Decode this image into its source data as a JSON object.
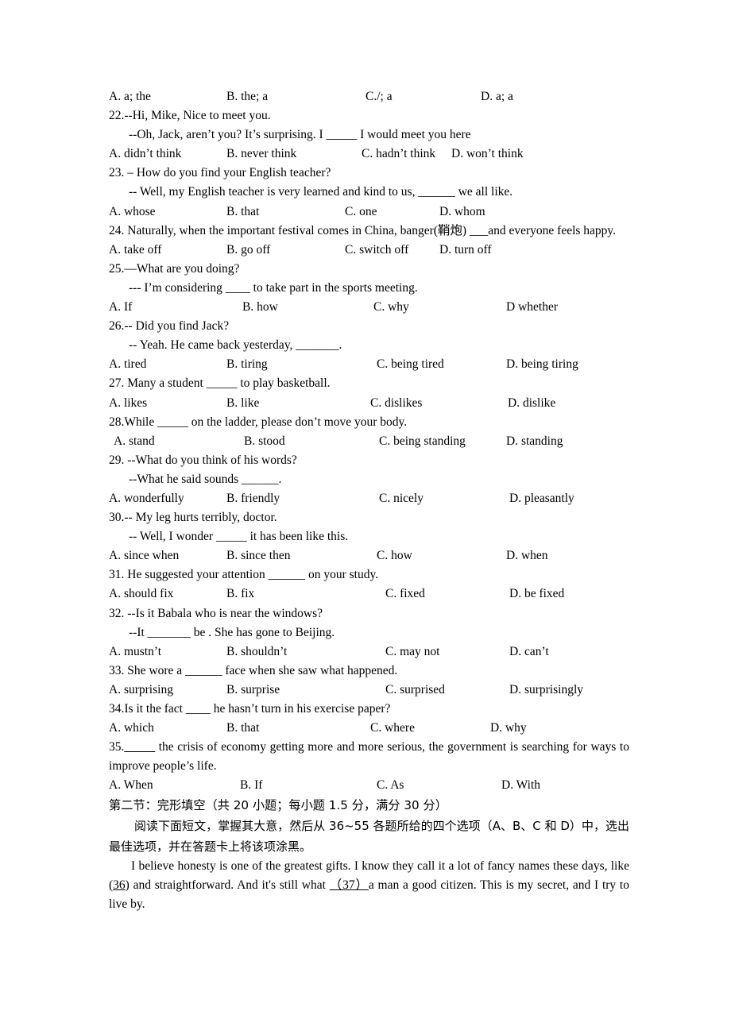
{
  "document": {
    "type": "english-exam-paper",
    "background_color": "#ffffff",
    "text_color": "#000000"
  },
  "q21_options": {
    "a": "A. a; the",
    "b": "B. the; a",
    "c": "C./; a",
    "d": "D. a; a"
  },
  "questions": [
    {
      "id": "q22",
      "stem": "22.--Hi, Mike, Nice to meet you.",
      "reply": "--Oh, Jack, aren’t you?   It’s surprising. I _____ I would meet you here",
      "options": [
        "A. didn’t think",
        "B. never think",
        "C. hadn’t think",
        "D. won’t think"
      ]
    },
    {
      "id": "q23",
      "stem": "23. – How do you find your English teacher?",
      "reply": "-- Well, my English teacher is very learned and kind to us, ______ we all like.",
      "options": [
        "A. whose",
        "B. that",
        "C. one",
        "D. whom"
      ]
    },
    {
      "id": "q24",
      "stem_html": "24. Naturally, when the important festival comes in China, banger(鞘炮) ___and everyone feels happy.",
      "options": [
        "A. take off",
        "B. go off",
        "C. switch off",
        "D. turn off"
      ]
    },
    {
      "id": "q25",
      "stem": "25.—What are you doing?",
      "reply": "--- I’m considering ____ to take part in the sports meeting.",
      "options": [
        "A.  If",
        "B. how",
        "C. why",
        "D whether"
      ]
    },
    {
      "id": "q26",
      "stem": "26.-- Did you find Jack?",
      "reply": "-- Yeah. He came back yesterday, _______.",
      "options": [
        "A. tired",
        "B. tiring",
        "C. being tired",
        "D. being tiring"
      ]
    },
    {
      "id": "q27",
      "stem": "27. Many a student _____ to play basketball.",
      "options": [
        "A. likes",
        "B. like",
        "C. dislikes",
        "D. dislike"
      ]
    },
    {
      "id": "q28",
      "stem": "28.While _____ on the ladder, please don’t move your body.",
      "options": [
        "A. stand",
        "B. stood",
        "C. being standing",
        "D. standing"
      ]
    },
    {
      "id": "q29",
      "stem": "29. --What do you think of his words?",
      "reply": "--What he said sounds ______.",
      "options": [
        "A. wonderfully",
        "B. friendly",
        "C. nicely",
        "D. pleasantly"
      ]
    },
    {
      "id": "q30",
      "stem": "30.-- My leg hurts terribly, doctor.",
      "reply": "-- Well, I wonder _____ it has been like this.",
      "options": [
        "A. since when",
        "B. since then",
        "C. how",
        "D. when"
      ]
    },
    {
      "id": "q31",
      "stem": "31. He suggested your attention ______ on your study.",
      "options": [
        "A. should fix",
        "B. fix",
        "C. fixed",
        "D. be fixed"
      ]
    },
    {
      "id": "q32",
      "stem": "32. --Is it Babala who is near the windows?",
      "reply": "--It _______ be . She has gone to Beijing.",
      "options": [
        "A. mustn’t",
        "B. shouldn’t",
        "C. may not",
        "D. can’t"
      ]
    },
    {
      "id": "q33",
      "stem": "33. She wore a ______ face when she saw what happened.",
      "options": [
        "A. surprising",
        "B. surprise",
        "C. surprised",
        "D. surprisingly"
      ]
    },
    {
      "id": "q34",
      "stem": "34.Is it the fact ____ he hasn’t turn in his exercise paper?",
      "options": [
        "A. which",
        "B. that",
        "C. where",
        "D. why"
      ]
    },
    {
      "id": "q35",
      "stem_part1": "35.",
      "stem_blank": "_____",
      "stem_part2": " the crisis of economy getting more and more serious, the government is searching for ways to improve people’s life.",
      "options": [
        "A. When",
        "B. If",
        "C. As",
        "D. With"
      ]
    }
  ],
  "section2": {
    "heading": "第二节：完形填空（共 20 小题；每小题 1.5 分，满分 30 分）",
    "instructions": "阅读下面短文，掌握其大意，然后从 36~55 各题所给的四个选项（A、B、C 和 D）中，选出最佳选项，并在答题卡上将该项涂黑。",
    "passage": {
      "part1": "I believe honesty is one of the greatest gifts. I know they call it a lot of fancy names these days, like ",
      "blank36": "(36)",
      "part2": " and straightforward. And it's still what  ",
      "blank37": "（37）",
      "part3": "a man a good citizen. This is my secret, and I try to live by."
    }
  }
}
